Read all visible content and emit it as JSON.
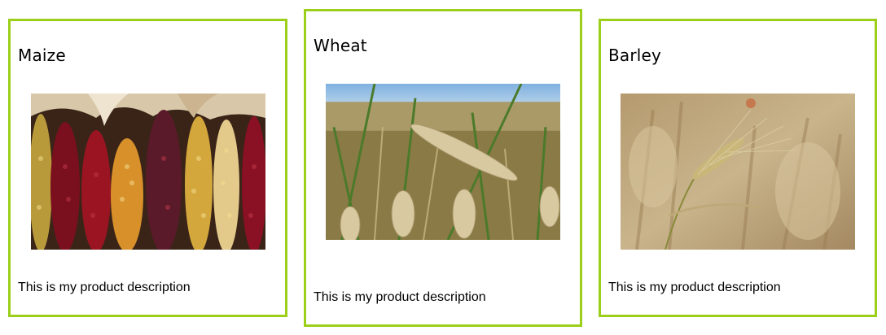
{
  "products": [
    {
      "title": "Maize",
      "description": "This is my product description",
      "image": "maize-photo"
    },
    {
      "title": "Wheat",
      "description": "This is my product description",
      "image": "wheat-photo"
    },
    {
      "title": "Barley",
      "description": "This is my product description",
      "image": "barley-photo"
    }
  ],
  "colors": {
    "card_border": "#9ccf1a"
  }
}
